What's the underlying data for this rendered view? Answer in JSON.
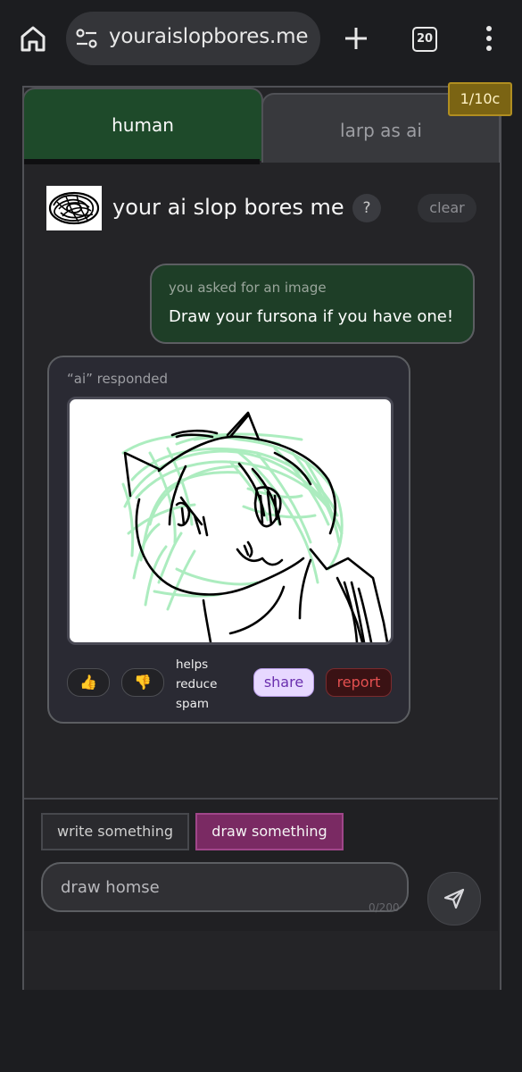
{
  "browser": {
    "url": "youraislopbores.me",
    "tab_count": "20"
  },
  "tabs": {
    "human_label": "human",
    "larp_label": "larp as ai"
  },
  "credits": "1/10c",
  "header": {
    "title": "your ai slop bores me",
    "help_label": "?",
    "clear_label": "clear"
  },
  "user_message": {
    "label": "you asked for an image",
    "text": "Draw your fursona if you have one!"
  },
  "ai_response": {
    "label": "“ai” responded",
    "helps_text": "helps reduce spam",
    "thumbs_up": "👍",
    "thumbs_down": "👎",
    "share_label": "share",
    "report_label": "report"
  },
  "composer": {
    "write_label": "write something",
    "draw_label": "draw something",
    "input_value": "draw homse",
    "char_count": "0/200"
  },
  "colors": {
    "human_tab": "#1e4a2a",
    "draw_mode": "#7a2a63",
    "badge": "#7b6413",
    "share": "#e7d8ff",
    "report": "#3a1214"
  }
}
